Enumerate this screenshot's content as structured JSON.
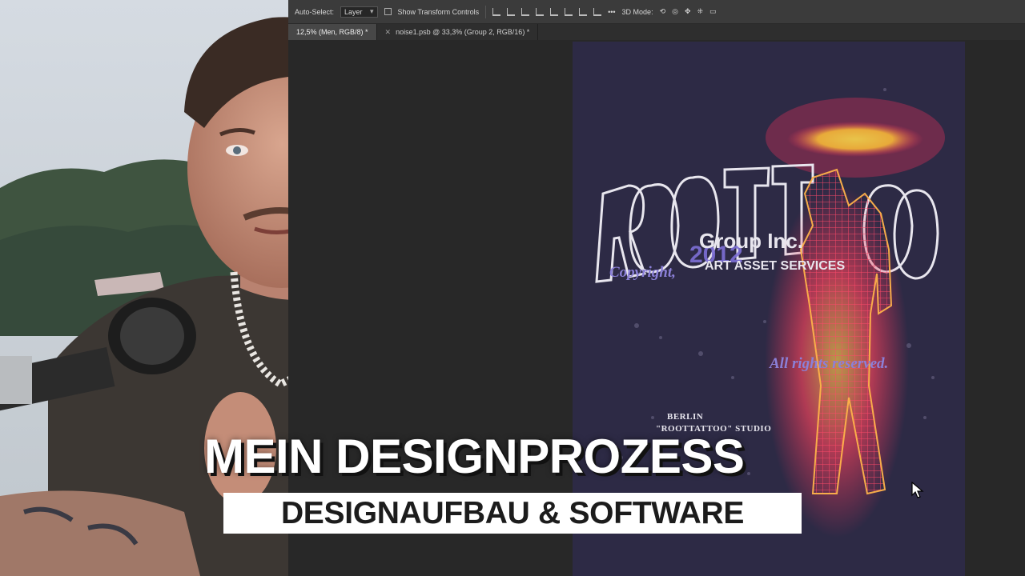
{
  "photoshop": {
    "options_bar": {
      "auto_select_label": "Auto-Select:",
      "auto_select_value": "Layer",
      "show_transform_controls": "Show Transform Controls",
      "mode_3d_label": "3D Mode:"
    },
    "tabs": [
      {
        "label": "12,5% (Men, RGB/8) *",
        "active": true
      },
      {
        "label": "noise1.psb @ 33,3% (Group 2, RGB/16) *",
        "active": false
      }
    ]
  },
  "artwork": {
    "group": "Group Inc.",
    "year": "2012",
    "copyright": "Copyright,",
    "services": "ART ASSET SERVICES",
    "rights": "All rights reserved.",
    "city": "BERLIN",
    "studio": "\"ROOTTATTOO\" STUDIO",
    "colors": {
      "background": "#2d2a45",
      "accent": "#7d6fd6",
      "glow": "#e8325a",
      "halo": "#e8c34a"
    }
  },
  "overlay": {
    "title": "MEIN DESIGNPROZESS",
    "subtitle": "DESIGNAUFBAU & SOFTWARE"
  }
}
